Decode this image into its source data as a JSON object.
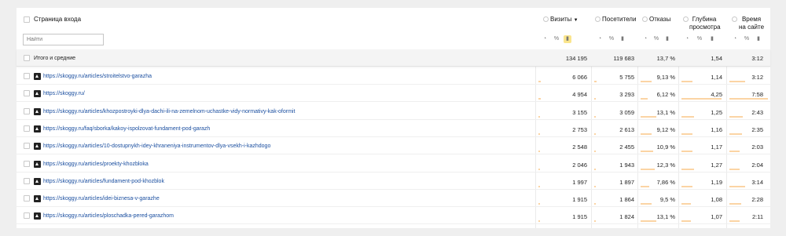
{
  "header": {
    "dimension_title": "Страница входа",
    "filter_placeholder": "Найти",
    "metrics": [
      {
        "id": "visits",
        "label": "Визиты",
        "sort": "▼"
      },
      {
        "id": "visitors",
        "label": "Посетители",
        "sort": ""
      },
      {
        "id": "bounce",
        "label": "Отказы",
        "sort": ""
      },
      {
        "id": "depth",
        "label": "Глубина просмотра",
        "line1": "Глубина",
        "line2": "просмотра"
      },
      {
        "id": "time",
        "label": "Время на сайте",
        "line1": "Время",
        "line2": "на сайте"
      }
    ]
  },
  "totals": {
    "label": "Итого и средние",
    "visits": "134 195",
    "visitors": "119 683",
    "bounce": "13,7 %",
    "depth": "1,54",
    "time": "3:12"
  },
  "rows": [
    {
      "url": "https://skoggy.ru/articles/stroitelstvo-garazha",
      "visits": "6 066",
      "visitors": "5 755",
      "bounce": "9,13 %",
      "depth": "1,14",
      "time": "3:12"
    },
    {
      "url": "https://skoggy.ru/",
      "visits": "4 954",
      "visitors": "3 293",
      "bounce": "6,12 %",
      "depth": "4,25",
      "time": "7:58"
    },
    {
      "url": "https://skoggy.ru/articles/khozpostroyki-dlya-dachi-ili-na-zemelnom-uchastke-vidy-normativy-kak-oformit",
      "visits": "3 155",
      "visitors": "3 059",
      "bounce": "13,1 %",
      "depth": "1,25",
      "time": "2:43"
    },
    {
      "url": "https://skoggy.ru/faq/sborka/kakoy-ispolzovat-fundament-pod-garazh",
      "visits": "2 753",
      "visitors": "2 613",
      "bounce": "9,12 %",
      "depth": "1,16",
      "time": "2:35"
    },
    {
      "url": "https://skoggy.ru/articles/10-dostupnykh-idey-khraneniya-instrumentov-dlya-vsekh-i-kazhdogo",
      "visits": "2 548",
      "visitors": "2 455",
      "bounce": "10,9 %",
      "depth": "1,17",
      "time": "2:03"
    },
    {
      "url": "https://skoggy.ru/articles/proekty-khozbloka",
      "visits": "2 046",
      "visitors": "1 943",
      "bounce": "12,3 %",
      "depth": "1,27",
      "time": "2:04"
    },
    {
      "url": "https://skoggy.ru/articles/fundament-pod-khozblok",
      "visits": "1 997",
      "visitors": "1 897",
      "bounce": "7,86 %",
      "depth": "1,19",
      "time": "3:14"
    },
    {
      "url": "https://skoggy.ru/articles/idei-biznesa-v-garazhe",
      "visits": "1 915",
      "visitors": "1 864",
      "bounce": "9,5 %",
      "depth": "1,08",
      "time": "2:28"
    },
    {
      "url": "https://skoggy.ru/articles/ploschadka-pered-garazhom",
      "visits": "1 915",
      "visitors": "1 824",
      "bounce": "13,1 %",
      "depth": "1,07",
      "time": "2:11"
    }
  ],
  "bar_fractions": {
    "visits": [
      0.05,
      0.04,
      0.025,
      0.02,
      0.02,
      0.015,
      0.015,
      0.015,
      0.015
    ],
    "visitors": [
      0.05,
      0.03,
      0.025,
      0.02,
      0.02,
      0.015,
      0.015,
      0.015,
      0.015
    ],
    "bounce": [
      0.3,
      0.2,
      0.45,
      0.3,
      0.35,
      0.4,
      0.25,
      0.3,
      0.45
    ],
    "depth": [
      0.25,
      0.95,
      0.3,
      0.25,
      0.25,
      0.3,
      0.25,
      0.22,
      0.22
    ],
    "time": [
      0.4,
      1.0,
      0.35,
      0.32,
      0.26,
      0.26,
      0.4,
      0.31,
      0.27
    ]
  },
  "colors": {
    "link": "#1b4fa0",
    "bar": "#fbd4a4",
    "active_icon": "#fae58d"
  },
  "icons": {
    "metric_view_icons": [
      "pie-chart-icon",
      "percent-icon",
      "bar-chart-icon"
    ]
  }
}
